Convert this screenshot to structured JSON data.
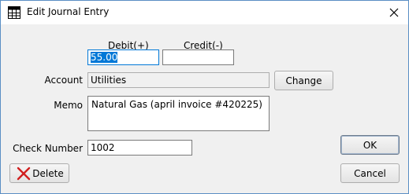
{
  "window": {
    "title": "Edit Journal Entry",
    "app_icon": "grid-icon",
    "close_icon": "close-icon"
  },
  "form": {
    "debit_label": "Debit(+)",
    "credit_label": "Credit(-)",
    "debit_value": "55.00",
    "credit_value": "",
    "account_label": "Account",
    "account_value": "Utilities",
    "memo_label": "Memo",
    "memo_value": "Natural Gas (april invoice #420225)",
    "check_number_label": "Check Number",
    "check_number_value": "1002"
  },
  "buttons": {
    "change_label": "Change",
    "ok_label": "OK",
    "delete_label": "Delete",
    "cancel_label": "Cancel"
  },
  "colors": {
    "selection": "#0078d7",
    "delete_icon": "#d11f1f"
  }
}
